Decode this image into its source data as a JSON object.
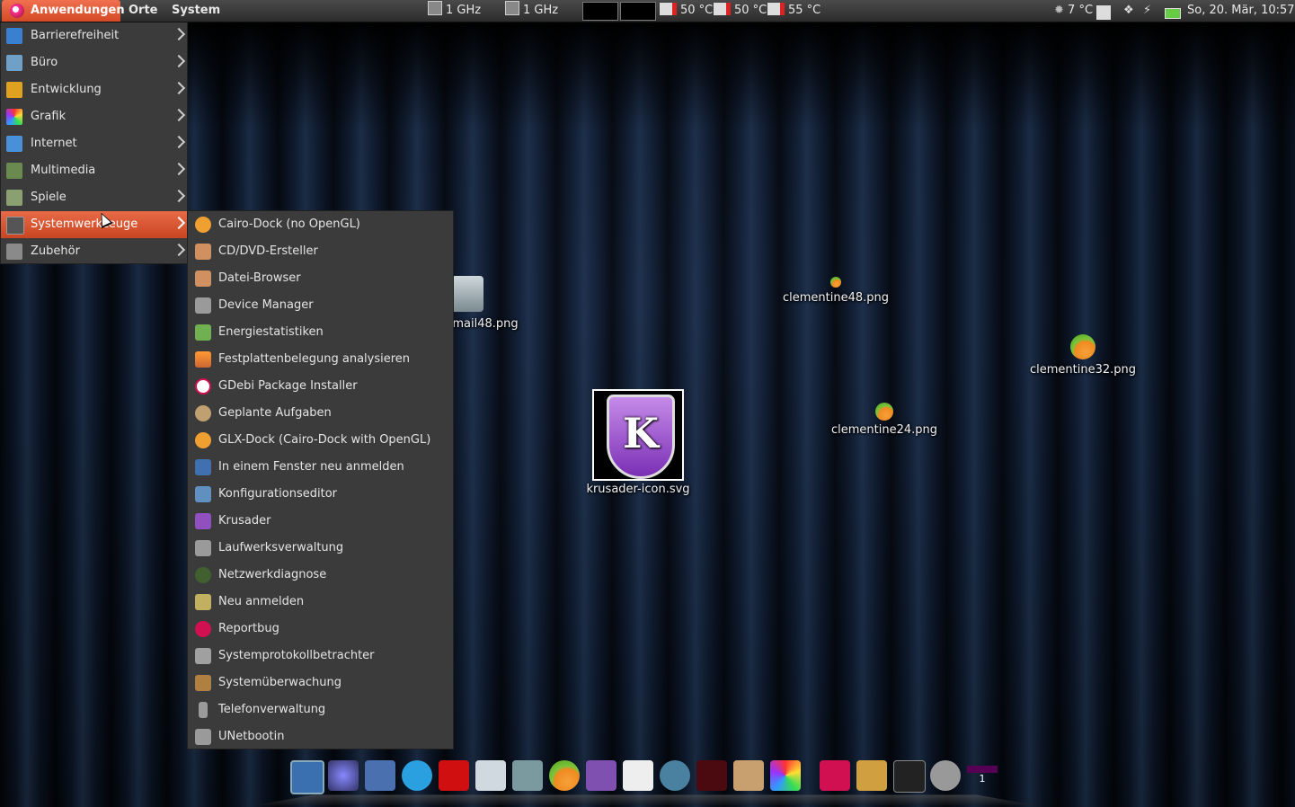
{
  "panel": {
    "apps_label": "Anwendungen",
    "places_label": "Orte",
    "system_label": "System",
    "cpu1": "1 GHz",
    "cpu2": "1 GHz",
    "temp1": "50 °C",
    "temp2": "50 °C",
    "temp3": "55 °C",
    "weather": "7 °C",
    "clock": "So, 20. Mär, 10:57"
  },
  "main_menu": {
    "items": [
      {
        "label": "Barrierefreiheit",
        "icon": "accessibility-icon",
        "color": "#3a7fd0"
      },
      {
        "label": "Büro",
        "icon": "office-icon",
        "color": "#6fa0c8"
      },
      {
        "label": "Entwicklung",
        "icon": "development-icon",
        "color": "#e0a020"
      },
      {
        "label": "Grafik",
        "icon": "graphics-icon",
        "color": "#d03070"
      },
      {
        "label": "Internet",
        "icon": "internet-icon",
        "color": "#4a90d8"
      },
      {
        "label": "Multimedia",
        "icon": "multimedia-icon",
        "color": "#6a8a50"
      },
      {
        "label": "Spiele",
        "icon": "games-icon",
        "color": "#8aa070"
      },
      {
        "label": "Systemwerkzeuge",
        "icon": "system-tools-icon",
        "color": "#555555"
      },
      {
        "label": "Zubehör",
        "icon": "accessories-icon",
        "color": "#8a8a8a"
      }
    ],
    "active_index": 7
  },
  "sub_menu": {
    "items": [
      {
        "label": "Cairo-Dock (no OpenGL)",
        "icon": "cairo-dock-icon",
        "color": "#f0a030"
      },
      {
        "label": "CD/DVD-Ersteller",
        "icon": "cd-burner-icon",
        "color": "#d09060"
      },
      {
        "label": "Datei-Browser",
        "icon": "file-browser-icon",
        "color": "#d09060"
      },
      {
        "label": "Device Manager",
        "icon": "device-manager-icon",
        "color": "#9a9a9a"
      },
      {
        "label": "Energiestatistiken",
        "icon": "power-stats-icon",
        "color": "#70b050"
      },
      {
        "label": "Festplattenbelegung analysieren",
        "icon": "disk-usage-icon",
        "color": "#c07040"
      },
      {
        "label": "GDebi Package Installer",
        "icon": "gdebi-icon",
        "color": "#d01050"
      },
      {
        "label": "Geplante Aufgaben",
        "icon": "scheduled-tasks-icon",
        "color": "#c0a070"
      },
      {
        "label": "GLX-Dock (Cairo-Dock with OpenGL)",
        "icon": "glx-dock-icon",
        "color": "#f0a030"
      },
      {
        "label": "In einem Fenster neu anmelden",
        "icon": "login-window-icon",
        "color": "#4070b0"
      },
      {
        "label": "Konfigurationseditor",
        "icon": "config-editor-icon",
        "color": "#6090c0"
      },
      {
        "label": "Krusader",
        "icon": "krusader-icon",
        "color": "#9050c0"
      },
      {
        "label": "Laufwerksverwaltung",
        "icon": "drive-manager-icon",
        "color": "#9a9a9a"
      },
      {
        "label": "Netzwerkdiagnose",
        "icon": "network-diagnose-icon",
        "color": "#406030"
      },
      {
        "label": "Neu anmelden",
        "icon": "relogin-icon",
        "color": "#c0b060"
      },
      {
        "label": "Reportbug",
        "icon": "reportbug-icon",
        "color": "#d01050"
      },
      {
        "label": "Systemprotokollbetrachter",
        "icon": "log-viewer-icon",
        "color": "#a0a0a0"
      },
      {
        "label": "Systemüberwachung",
        "icon": "system-monitor-icon",
        "color": "#b08040"
      },
      {
        "label": "Telefonverwaltung",
        "icon": "phone-manager-icon",
        "color": "#9a9a9a"
      },
      {
        "label": "UNetbootin",
        "icon": "unetbootin-icon",
        "color": "#9a9a9a"
      }
    ]
  },
  "desktop": {
    "icons": [
      {
        "name": "mail48.png"
      },
      {
        "name": "clementine48.png"
      },
      {
        "name": "clementine32.png"
      },
      {
        "name": "clementine24.png"
      },
      {
        "name": "krusader-icon.svg"
      }
    ]
  },
  "dock": {
    "items": [
      "search-icon",
      "web-browser-icon",
      "pidgin-icon",
      "skype-icon",
      "filezilla-icon",
      "network-icon",
      "mail-icon",
      "clementine-icon",
      "krusader-icon",
      "text-editor-icon",
      "globe-icon",
      "terminal-icon",
      "package-icon",
      "color-icon",
      "debian-icon",
      "folder-icon",
      "console-icon",
      "volume-icon",
      "workspace-icon"
    ],
    "workspace_number": "1"
  }
}
